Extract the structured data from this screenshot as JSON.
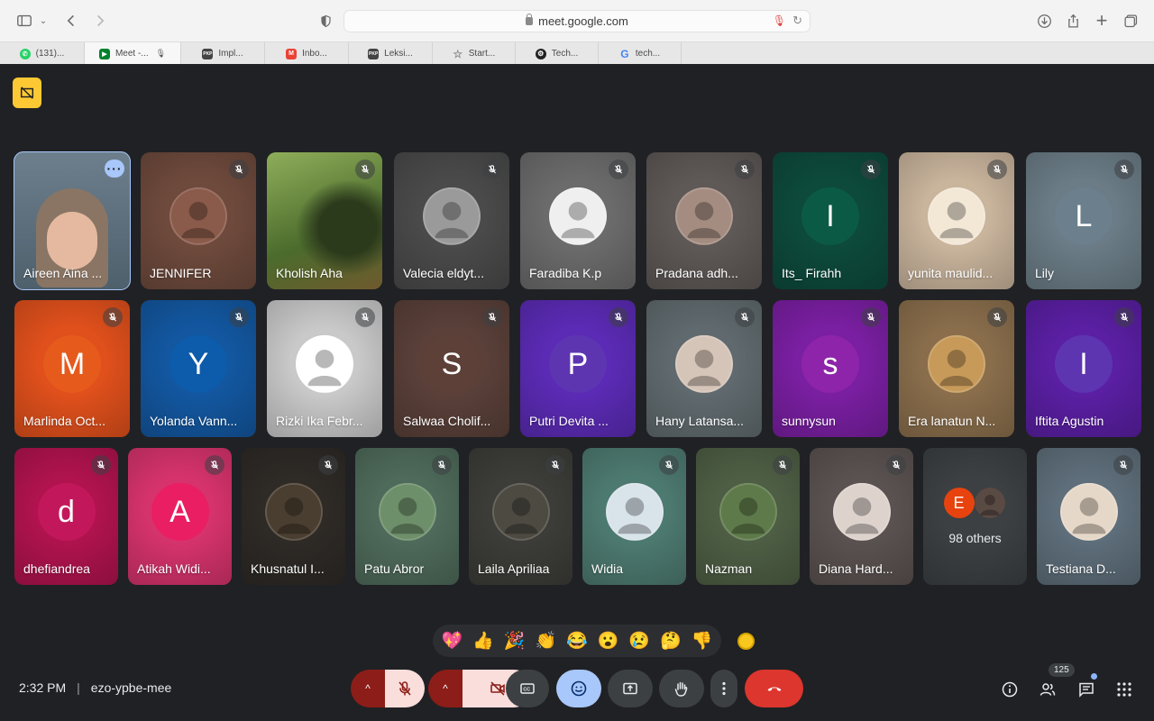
{
  "browser": {
    "url": "meet.google.com",
    "tabs": [
      {
        "label": "(131)...",
        "favicon": "whatsapp-icon",
        "color": "#25d366"
      },
      {
        "label": "Meet -...",
        "favicon": "meet-icon",
        "color": "#00832d",
        "active": true,
        "audio": true
      },
      {
        "label": "Impl...",
        "favicon": "pkp-icon",
        "color": "#444444"
      },
      {
        "label": "Inbo...",
        "favicon": "gmail-icon",
        "color": "#ea4335"
      },
      {
        "label": "Leksi...",
        "favicon": "pkp-icon",
        "color": "#444444"
      },
      {
        "label": "Start...",
        "favicon": "star-icon",
        "color": "#888888"
      },
      {
        "label": "Tech...",
        "favicon": "openai-icon",
        "color": "#222222"
      },
      {
        "label": "tech...",
        "favicon": "google-icon",
        "color": "#4285f4"
      }
    ]
  },
  "meeting": {
    "time": "2:32 PM",
    "code": "ezo-ypbe-mee",
    "participant_count": "125",
    "others_label": "98 others",
    "others_initial": "E"
  },
  "participants": [
    {
      "name": "Aireen Aina ...",
      "type": "video",
      "bg": "#5a6e7e",
      "speaking": true
    },
    {
      "name": "JENNIFER",
      "type": "photo",
      "bg": "#6e4a3c",
      "avatar_color": "#8a5a4a"
    },
    {
      "name": "Kholish Aha",
      "type": "photo-full",
      "bg": "#5b7a3a"
    },
    {
      "name": "Valecia eldyt...",
      "type": "photo",
      "bg": "#4a4a4a",
      "avatar_color": "#9a9a9a"
    },
    {
      "name": "Faradiba K.p",
      "type": "photo",
      "bg": "#6b6b6b",
      "avatar_color": "#efefef"
    },
    {
      "name": "Pradana adh...",
      "type": "photo",
      "bg": "#5e5856",
      "avatar_color": "#a48c80"
    },
    {
      "name": "Its_ Firahh",
      "type": "initial",
      "initial": "I",
      "bg": "#0d4a3c",
      "avatar_color": "#0b5a45"
    },
    {
      "name": "yunita maulid...",
      "type": "photo",
      "bg": "#c9b49c",
      "avatar_color": "#f3e7d6"
    },
    {
      "name": "Lily",
      "type": "initial",
      "initial": "L",
      "bg": "#6b7c86",
      "avatar_color": "#6b7f8c"
    },
    {
      "name": "Marlinda Oct...",
      "type": "initial",
      "initial": "M",
      "bg": "#e0501c",
      "avatar_color": "#e65a1c"
    },
    {
      "name": "Yolanda Vann...",
      "type": "initial",
      "initial": "Y",
      "bg": "#1357a0",
      "avatar_color": "#0d5bab"
    },
    {
      "name": "Rizki Ika Febr...",
      "type": "photo",
      "bg": "#c9c9c9",
      "avatar_color": "#ffffff"
    },
    {
      "name": "Salwaa Cholif...",
      "type": "initial",
      "initial": "S",
      "bg": "#5a4039",
      "avatar_color": "#5d4037"
    },
    {
      "name": "Putri Devita ...",
      "type": "initial",
      "initial": "P",
      "bg": "#5b2bb5",
      "avatar_color": "#5e35b1"
    },
    {
      "name": "Hany Latansa...",
      "type": "photo",
      "bg": "#606a6e",
      "avatar_color": "#d5c4b8"
    },
    {
      "name": "sunnysun",
      "type": "initial",
      "initial": "s",
      "bg": "#7a1fa2",
      "avatar_color": "#8e24aa"
    },
    {
      "name": "Era lanatun N...",
      "type": "photo",
      "bg": "#8a6e4c",
      "avatar_color": "#c79a5a"
    },
    {
      "name": "Iftita Agustin",
      "type": "initial",
      "initial": "I",
      "bg": "#5a1fa3",
      "avatar_color": "#5e35b1"
    },
    {
      "name": "dhefiandrea",
      "type": "initial",
      "initial": "d",
      "bg": "#b0134e",
      "avatar_color": "#c2185b"
    },
    {
      "name": "Atikah Widi...",
      "type": "initial",
      "initial": "A",
      "bg": "#d6336c",
      "avatar_color": "#e91e63"
    },
    {
      "name": "Khusnatul I...",
      "type": "photo",
      "bg": "#2e2a26",
      "avatar_color": "#4a3e30"
    },
    {
      "name": "Patu Abror",
      "type": "photo",
      "bg": "#4e6a5a",
      "avatar_color": "#6d8f6a"
    },
    {
      "name": "Laila Apriliaa",
      "type": "photo",
      "bg": "#3c3c38",
      "avatar_color": "#4d4a42"
    },
    {
      "name": "Widia",
      "type": "photo",
      "bg": "#4d7a70",
      "avatar_color": "#d9e3ea"
    },
    {
      "name": "Nazman",
      "type": "photo",
      "bg": "#4e5e44",
      "avatar_color": "#5f7a4a"
    },
    {
      "name": "Diana Hard...",
      "type": "photo",
      "bg": "#5a5250",
      "avatar_color": "#ddd2cc"
    },
    {
      "name": "98 others",
      "type": "others",
      "bg": "#3c4043"
    },
    {
      "name": "Testiana D...",
      "type": "photo",
      "bg": "#5e6e7a",
      "avatar_color": "#e6d8c8"
    }
  ],
  "reactions": [
    "💖",
    "👍",
    "🎉",
    "👏",
    "😂",
    "😮",
    "😢",
    "🤔",
    "👎"
  ],
  "controls": {
    "mic_color": "#f9dedc",
    "end_call_color": "#dc362e",
    "emoji_active_color": "#a8c7fa"
  }
}
